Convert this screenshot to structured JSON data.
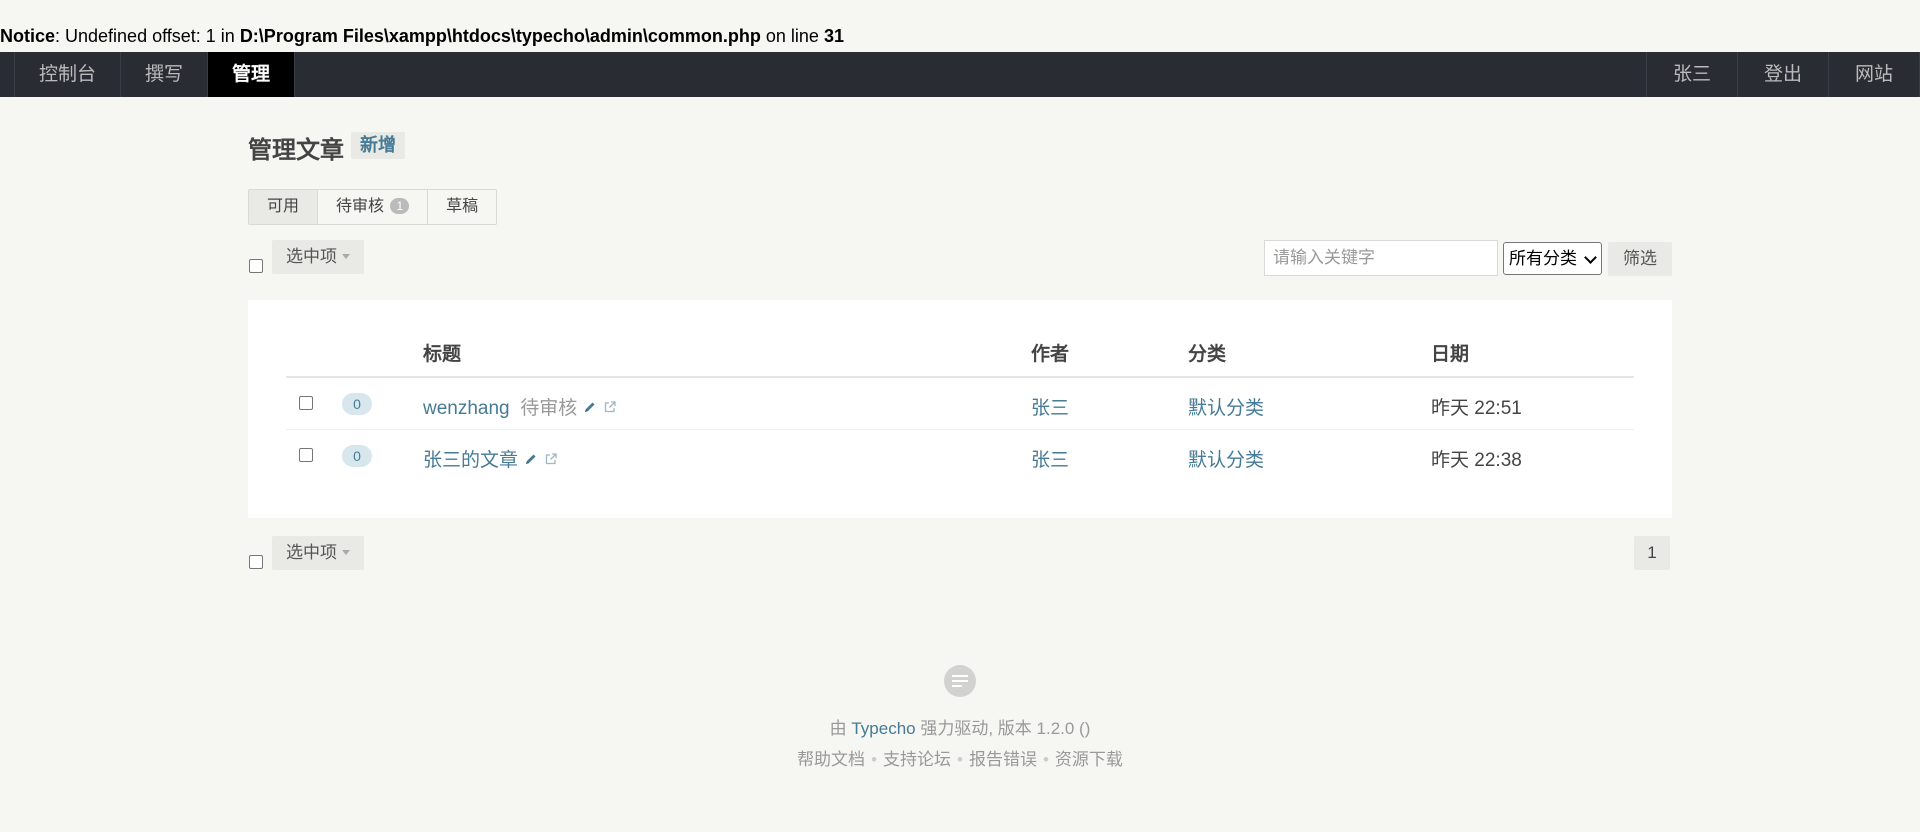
{
  "notice": {
    "label": "Notice",
    "message": ": Undefined offset: 1 in ",
    "path": "D:\\Program Files\\xampp\\htdocs\\typecho\\admin\\common.php",
    "on_line": " on line ",
    "line": "31"
  },
  "nav": {
    "left": [
      {
        "label": "控制台"
      },
      {
        "label": "撰写"
      },
      {
        "label": "管理",
        "active": true
      }
    ],
    "right": [
      {
        "label": "张三"
      },
      {
        "label": "登出"
      },
      {
        "label": "网站"
      }
    ]
  },
  "page": {
    "title": "管理文章",
    "new_label": "新增"
  },
  "tabs": [
    {
      "label": "可用",
      "active": true
    },
    {
      "label": "待审核",
      "badge": "1"
    },
    {
      "label": "草稿"
    }
  ],
  "operate": {
    "selected_label": "选中项",
    "search_placeholder": "请输入关键字",
    "category_selected": "所有分类",
    "filter_label": "筛选"
  },
  "table": {
    "headers": {
      "title": "标题",
      "author": "作者",
      "category": "分类",
      "date": "日期"
    },
    "rows": [
      {
        "comments": "0",
        "title": "wenzhang",
        "status": "待审核",
        "author": "张三",
        "category": "默认分类",
        "date": "昨天 22:51"
      },
      {
        "comments": "0",
        "title": "张三的文章",
        "status": "",
        "author": "张三",
        "category": "默认分类",
        "date": "昨天 22:38"
      }
    ]
  },
  "pagination": {
    "current": "1"
  },
  "footer": {
    "by": "由 ",
    "brand": "Typecho",
    "powered": " 强力驱动, 版本 1.2.0 ()",
    "links": [
      "帮助文档",
      "支持论坛",
      "报告错误",
      "资源下载"
    ],
    "separator": "•"
  },
  "colors": {
    "background": "#F6F6F3",
    "topbar": "#292D33",
    "link": "#467B96",
    "button": "#E9E9E6"
  }
}
